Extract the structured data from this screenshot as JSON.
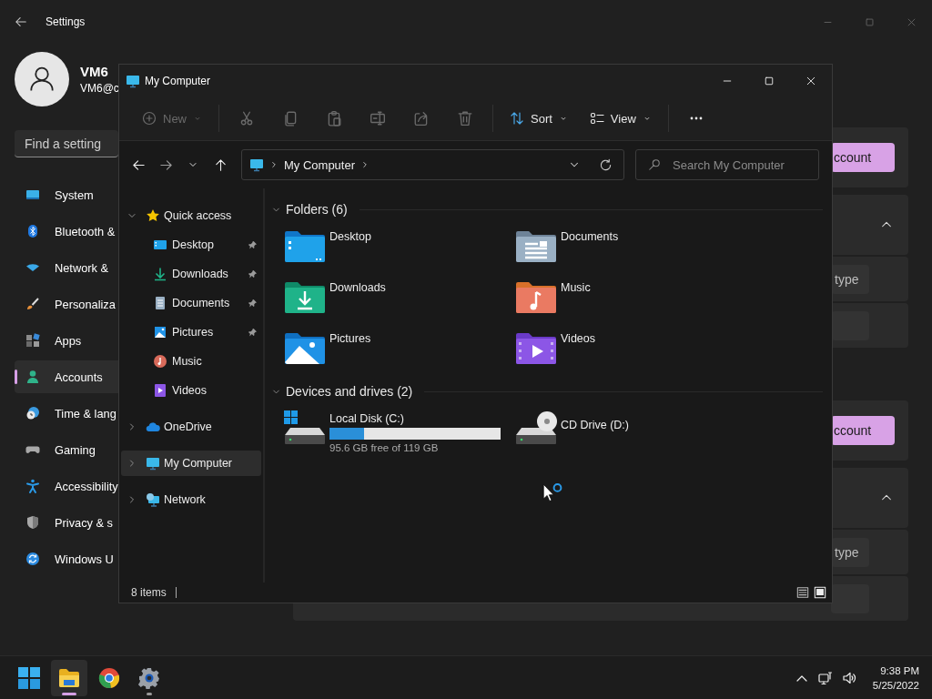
{
  "settings": {
    "title": "Settings",
    "user": {
      "name": "VM6",
      "email": "VM6@c"
    },
    "search": {
      "placeholder": "Find a setting"
    },
    "nav": [
      {
        "label": "System",
        "kind": "system",
        "selected": false
      },
      {
        "label": "Bluetooth &",
        "kind": "bluetooth",
        "selected": false
      },
      {
        "label": "Network &",
        "kind": "network",
        "selected": false
      },
      {
        "label": "Personaliza",
        "kind": "brush",
        "selected": false
      },
      {
        "label": "Apps",
        "kind": "apps",
        "selected": false
      },
      {
        "label": "Accounts",
        "kind": "accounts",
        "selected": true
      },
      {
        "label": "Time & lang",
        "kind": "time",
        "selected": false
      },
      {
        "label": "Gaming",
        "kind": "gaming",
        "selected": false
      },
      {
        "label": "Accessibility",
        "kind": "accessibility",
        "selected": false
      },
      {
        "label": "Privacy & s",
        "kind": "privacy",
        "selected": false
      },
      {
        "label": "Windows U",
        "kind": "update",
        "selected": false
      }
    ],
    "sections": [
      {
        "groups": [
          {
            "rows": [
              {
                "kind": "button",
                "label": "ccount"
              }
            ]
          },
          {
            "rows": [
              {
                "kind": "expander",
                "expanded": true
              },
              {
                "kind": "small_button",
                "label": "type"
              },
              {
                "kind": "blank"
              }
            ]
          }
        ]
      },
      {
        "groups": [
          {
            "rows": [
              {
                "kind": "button",
                "label": "ccount"
              }
            ]
          },
          {
            "rows": [
              {
                "kind": "expander",
                "expanded": true
              },
              {
                "kind": "small_button",
                "label": "type"
              },
              {
                "kind": "blank"
              }
            ]
          }
        ]
      }
    ]
  },
  "explorer": {
    "title": "My Computer",
    "toolbar": [
      {
        "kind": "new",
        "label": "New",
        "disabled": true
      },
      {
        "kind": "cut",
        "disabled": true
      },
      {
        "kind": "copy",
        "disabled": true
      },
      {
        "kind": "paste",
        "disabled": true
      },
      {
        "kind": "rename",
        "disabled": true
      },
      {
        "kind": "share",
        "disabled": true
      },
      {
        "kind": "delete",
        "disabled": true
      },
      {
        "kind": "sort",
        "label": "Sort",
        "disabled": false
      },
      {
        "kind": "view",
        "label": "View",
        "disabled": false
      },
      {
        "kind": "more",
        "disabled": false
      }
    ],
    "address": {
      "path": [
        "My Computer"
      ]
    },
    "search": {
      "placeholder": "Search My Computer"
    },
    "nav": [
      {
        "label": "Quick access",
        "kind": "star",
        "expanded": true,
        "selected": false,
        "children": [
          {
            "label": "Desktop",
            "kind": "desktop",
            "pinned": true
          },
          {
            "label": "Downloads",
            "kind": "downloads",
            "pinned": true
          },
          {
            "label": "Documents",
            "kind": "documents",
            "pinned": true
          },
          {
            "label": "Pictures",
            "kind": "pictures",
            "pinned": true
          },
          {
            "label": "Music",
            "kind": "music",
            "pinned": false
          },
          {
            "label": "Videos",
            "kind": "videos",
            "pinned": false
          }
        ]
      },
      {
        "label": "OneDrive",
        "kind": "cloud",
        "expanded": false,
        "selected": false
      },
      {
        "label": "My Computer",
        "kind": "computer",
        "expanded": false,
        "selected": true
      },
      {
        "label": "Network",
        "kind": "netpc",
        "expanded": false,
        "selected": false
      }
    ],
    "groups": [
      {
        "title": "Folders (6)",
        "expanded": true,
        "items": [
          {
            "label": "Desktop",
            "kind": "desktop"
          },
          {
            "label": "Documents",
            "kind": "documents"
          },
          {
            "label": "Downloads",
            "kind": "downloads"
          },
          {
            "label": "Music",
            "kind": "music"
          },
          {
            "label": "Pictures",
            "kind": "pictures"
          },
          {
            "label": "Videos",
            "kind": "videos"
          }
        ]
      },
      {
        "title": "Devices and drives (2)",
        "expanded": true,
        "items": [
          {
            "label": "Local Disk (C:)",
            "kind": "disk",
            "level": 0.2,
            "detail": "95.6 GB free of 119 GB"
          },
          {
            "label": "CD Drive (D:)",
            "kind": "cd"
          }
        ]
      }
    ],
    "status": "8 items",
    "views": [
      {
        "kind": "details",
        "selected": false
      },
      {
        "kind": "large",
        "selected": true
      }
    ]
  },
  "taskbar": {
    "apps": [
      {
        "kind": "start",
        "running": false,
        "selected": false
      },
      {
        "kind": "explorer",
        "running": true,
        "selected": true
      },
      {
        "kind": "browser",
        "running": false,
        "selected": false
      },
      {
        "kind": "settings",
        "running": true,
        "selected": false
      }
    ],
    "time": "9:38 PM",
    "date": "5/25/2022"
  }
}
